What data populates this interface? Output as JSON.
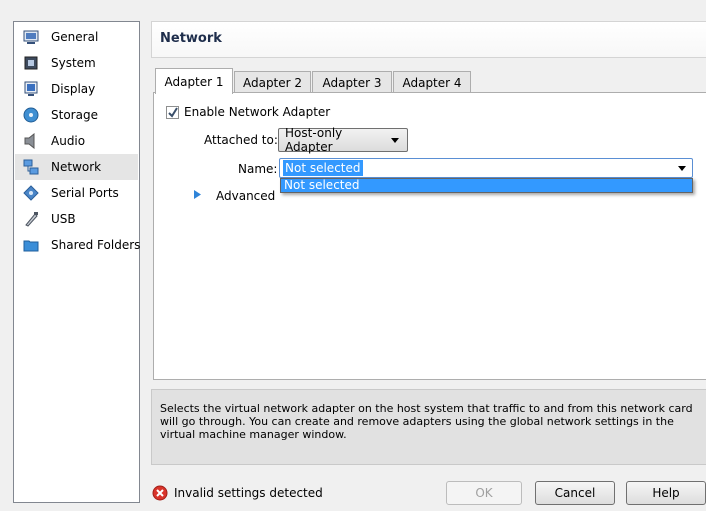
{
  "sidebar": {
    "items": [
      {
        "label": "General",
        "icon": "general-icon"
      },
      {
        "label": "System",
        "icon": "system-icon"
      },
      {
        "label": "Display",
        "icon": "display-icon"
      },
      {
        "label": "Storage",
        "icon": "storage-icon"
      },
      {
        "label": "Audio",
        "icon": "audio-icon"
      },
      {
        "label": "Network",
        "icon": "network-icon",
        "selected": true
      },
      {
        "label": "Serial Ports",
        "icon": "serial-ports-icon"
      },
      {
        "label": "USB",
        "icon": "usb-icon"
      },
      {
        "label": "Shared Folders",
        "icon": "shared-folders-icon"
      }
    ]
  },
  "header": {
    "title": "Network"
  },
  "tabs": [
    {
      "label": "Adapter 1",
      "active": true
    },
    {
      "label": "Adapter 2"
    },
    {
      "label": "Adapter 3"
    },
    {
      "label": "Adapter 4"
    }
  ],
  "adapter": {
    "enable_label": "Enable Network Adapter",
    "enabled": true,
    "attached_label": "Attached to:",
    "attached_value": "Host-only Adapter",
    "name_label": "Name:",
    "name_value": "Not selected",
    "name_options": [
      "Not selected"
    ],
    "advanced_label": "Advanced"
  },
  "description": "Selects the virtual network adapter on the host system that traffic to and from this network card will go through. You can create and remove adapters using the global network settings in the virtual machine manager window.",
  "footer": {
    "status_text": "Invalid settings detected",
    "ok_label": "OK",
    "cancel_label": "Cancel",
    "help_label": "Help"
  },
  "colors": {
    "selection": "#3399ff",
    "error": "#d9342b",
    "header_title": "#1e2d4b"
  }
}
